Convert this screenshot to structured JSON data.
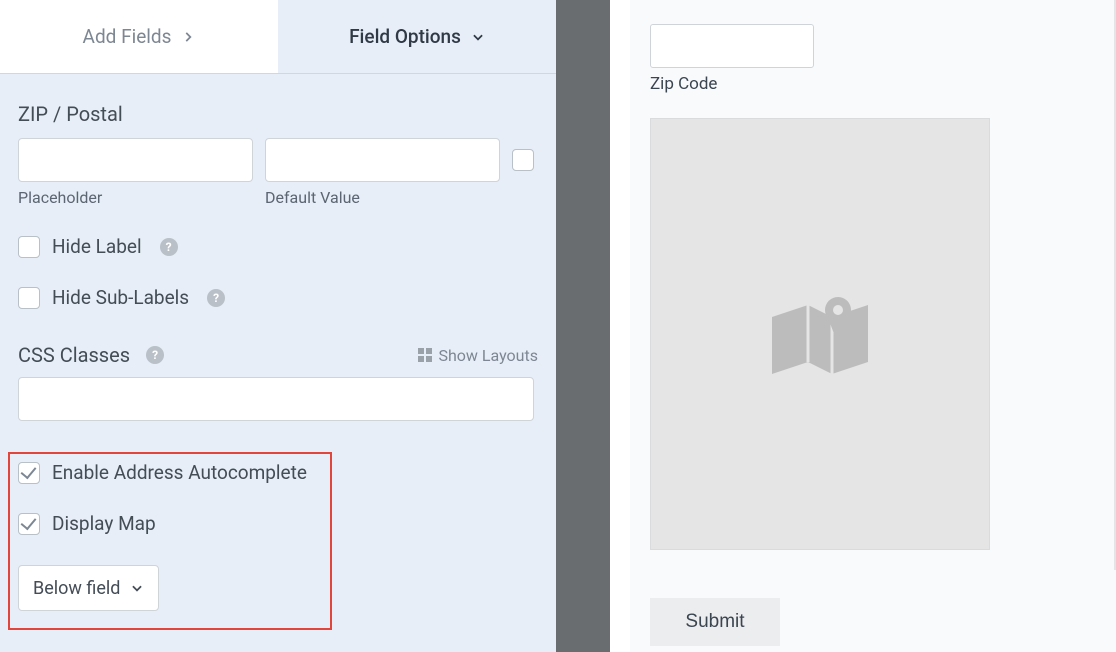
{
  "tabs": {
    "add_fields": "Add Fields",
    "field_options": "Field Options"
  },
  "zip_postal": {
    "section_label": "ZIP / Postal",
    "placeholder_label": "Placeholder",
    "default_value_label": "Default Value"
  },
  "options": {
    "hide_label": "Hide Label",
    "hide_sub_labels": "Hide Sub-Labels"
  },
  "css_classes": {
    "label": "CSS Classes",
    "show_layouts": "Show Layouts"
  },
  "autocomplete": {
    "enable_label": "Enable Address Autocomplete",
    "display_map_label": "Display Map",
    "map_position": "Below field"
  },
  "preview": {
    "zip_label": "Zip Code",
    "submit_label": "Submit"
  }
}
